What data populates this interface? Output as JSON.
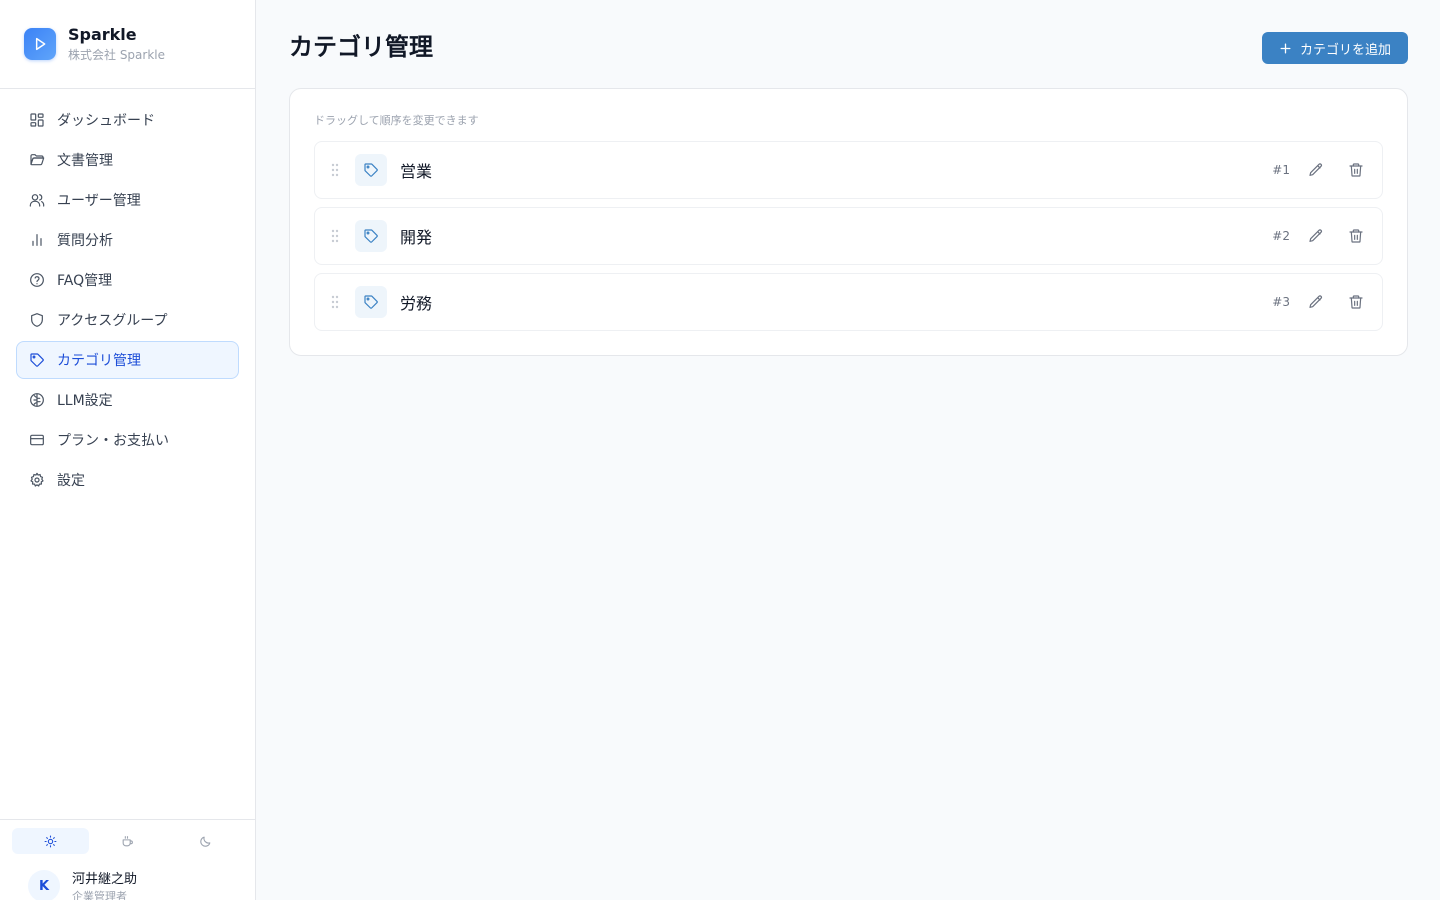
{
  "brand": {
    "name": "Sparkle",
    "company": "株式会社 Sparkle"
  },
  "nav": [
    {
      "label": "ダッシュボード",
      "icon": "dashboard-icon",
      "active": false
    },
    {
      "label": "文書管理",
      "icon": "folder-icon",
      "active": false
    },
    {
      "label": "ユーザー管理",
      "icon": "users-icon",
      "active": false
    },
    {
      "label": "質問分析",
      "icon": "bar-chart-icon",
      "active": false
    },
    {
      "label": "FAQ管理",
      "icon": "help-circle-icon",
      "active": false
    },
    {
      "label": "アクセスグループ",
      "icon": "shield-icon",
      "active": false
    },
    {
      "label": "カテゴリ管理",
      "icon": "tag-icon",
      "active": true
    },
    {
      "label": "LLM設定",
      "icon": "brain-icon",
      "active": false
    },
    {
      "label": "プラン・お支払い",
      "icon": "credit-card-icon",
      "active": false
    },
    {
      "label": "設定",
      "icon": "gear-icon",
      "active": false
    }
  ],
  "theme": {
    "options": [
      "sun-icon",
      "coffee-icon",
      "moon-icon"
    ],
    "selected": "sun-icon"
  },
  "user": {
    "initial": "K",
    "name": "河井継之助",
    "role": "企業管理者"
  },
  "page": {
    "title": "カテゴリ管理",
    "add_label": "カテゴリを追加",
    "hint": "ドラッグして順序を変更できます"
  },
  "categories": [
    {
      "name": "営業",
      "order": "#1"
    },
    {
      "name": "開発",
      "order": "#2"
    },
    {
      "name": "労務",
      "order": "#3"
    }
  ],
  "colors": {
    "accent": "#3b82c4",
    "active_bg": "#eff6ff",
    "active_text": "#1d4ed8"
  }
}
